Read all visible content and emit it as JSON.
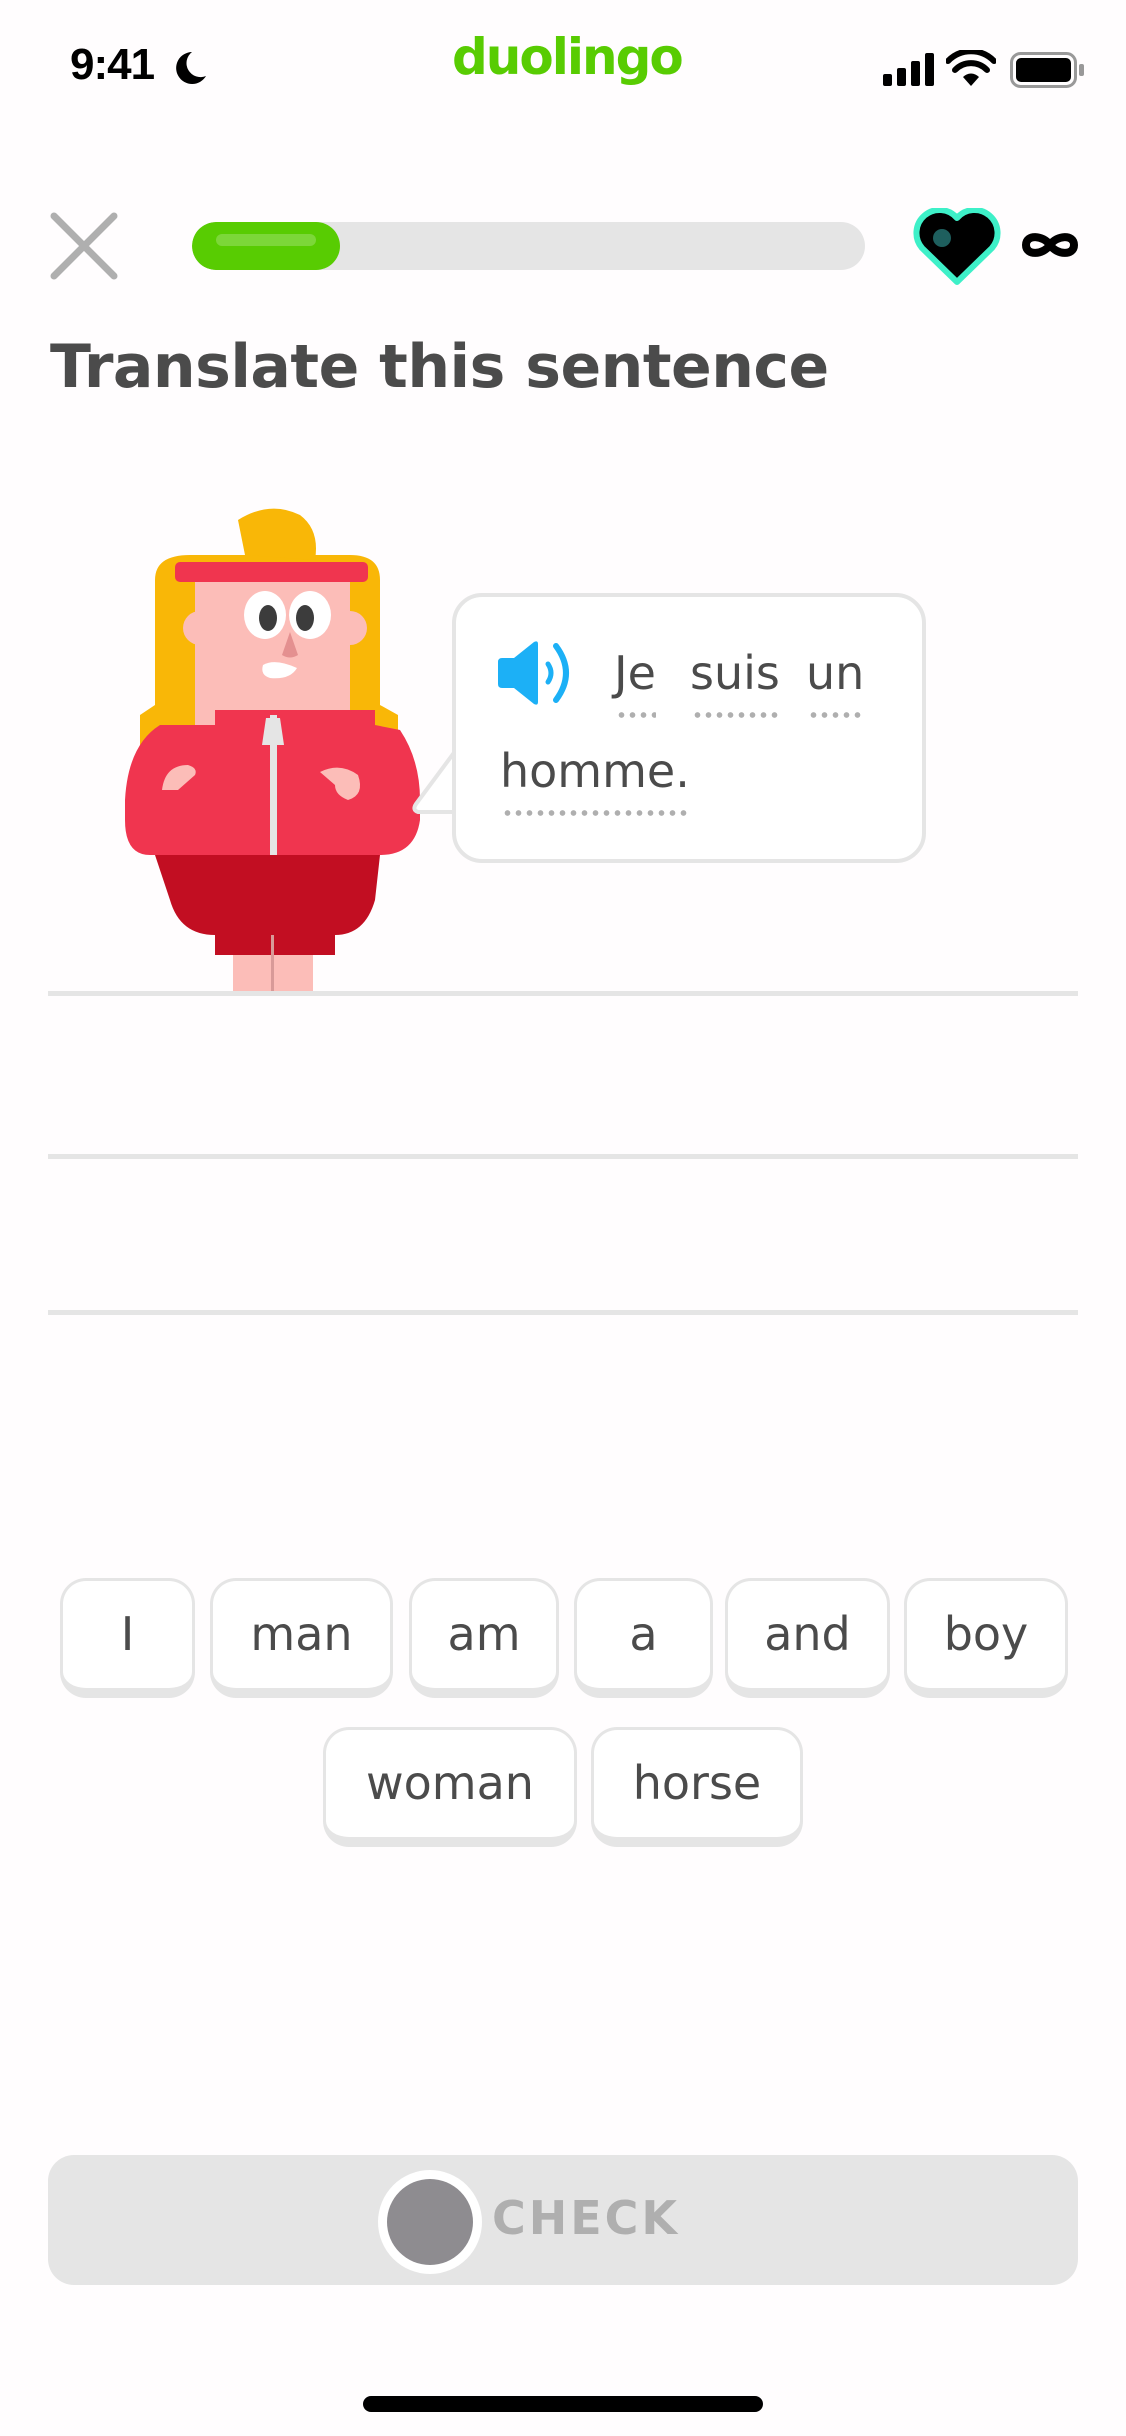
{
  "status_bar": {
    "time": "9:41",
    "focus_icon": "moon-icon",
    "brand": "duolingo",
    "icons": [
      "cellular-signal-icon",
      "wifi-icon",
      "battery-icon"
    ]
  },
  "header": {
    "close_icon": "close-icon",
    "progress_fraction": 0.22,
    "hearts_icon": "heart-icon",
    "hearts_value": "∞"
  },
  "colors": {
    "brand_green": "#58cc02",
    "heart_outline": "#3ef0c8",
    "speaker_blue": "#1cb0f6",
    "text_dark": "#4b4b4b",
    "disabled_gray": "#e5e5e5"
  },
  "exercise": {
    "title": "Translate this sentence",
    "speaker_icon": "speaker-icon",
    "prompt_words": [
      "Je",
      "suis",
      "un",
      "homme."
    ],
    "answer_slots": []
  },
  "word_bank": {
    "tiles": [
      "I",
      "man",
      "am",
      "a",
      "and",
      "boy",
      "woman",
      "horse"
    ]
  },
  "footer": {
    "check_label": "CHECK",
    "check_enabled": false
  }
}
